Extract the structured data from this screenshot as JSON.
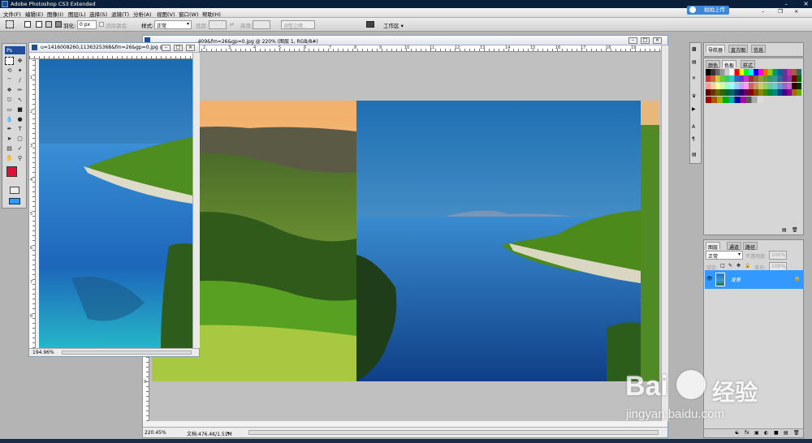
{
  "app": {
    "title": "Adobe Photoshop CS3 Extended",
    "badge": "Ps"
  },
  "menu": [
    "文件(F)",
    "编辑(E)",
    "图像(I)",
    "图层(L)",
    "选择(S)",
    "滤镜(T)",
    "分析(A)",
    "视图(V)",
    "窗口(W)",
    "帮助(H)"
  ],
  "cloud_button": "拍拍上传",
  "options_bar": {
    "feather_label": "羽化:",
    "feather_value": "0 px",
    "antialias_label": "消除锯齿",
    "style_label": "样式:",
    "style_value": "正常",
    "width_label": "宽度:",
    "height_label": "高度:",
    "refine_edge_button": "调整边缘...",
    "workspace_label": "工作区"
  },
  "doc_left": {
    "title": "u=1416008260,1136325368&fm=26&gp=0.jpg @ ...",
    "zoom": "194.96%"
  },
  "doc_main": {
    "title": "...409&fm=26&gp=0.jpg @ 220% (图层 1, RGB/8#)",
    "zoom": "220.45%",
    "doc_info": "文档:476.4K/1.51M"
  },
  "ruler_marks": {
    "left_v": [
      "1",
      "2",
      "3",
      "4",
      "5",
      "6",
      "7",
      "8"
    ],
    "main_h": [
      "0",
      "1",
      "2",
      "3",
      "4",
      "5",
      "6",
      "7",
      "8",
      "9",
      "10",
      "11",
      "12",
      "13",
      "14",
      "15",
      "16",
      "17",
      "18",
      "19"
    ],
    "main_v": [
      "1",
      "2",
      "3",
      "4",
      "5",
      "6",
      "7",
      "8",
      "9"
    ]
  },
  "nav_panel": {
    "tabs": [
      "导航器",
      "直方图",
      "信息"
    ],
    "tabs2": [
      "颜色",
      "色板",
      "样式"
    ]
  },
  "layers_panel": {
    "tabs": [
      "图层",
      "通道",
      "路径"
    ],
    "blend_mode": "正常",
    "opacity_label": "不透明度:",
    "opacity_value": "100%",
    "lock_label": "锁定:",
    "fill_label": "填充:",
    "fill_value": "100%",
    "layer_name": "背景"
  },
  "watermark": {
    "brand": "Bai",
    "brand2": "经验",
    "url": "jingyan.baidu.com"
  },
  "colors": {
    "foreground": "#e0103a",
    "selection": "#3399ff"
  }
}
